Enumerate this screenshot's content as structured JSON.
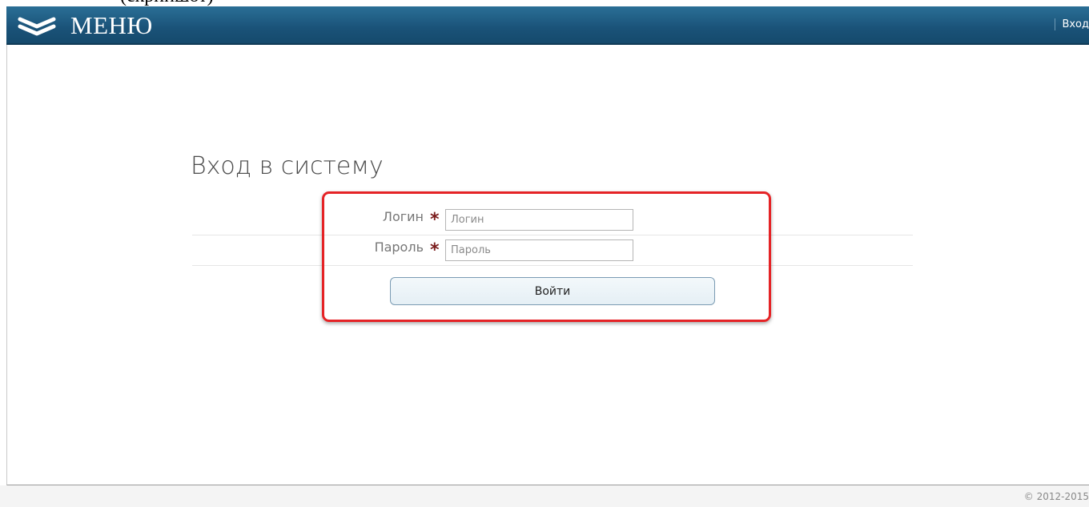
{
  "header": {
    "menu_title": "МЕНЮ",
    "login_link": "Вход",
    "menu_icon": "double-chevron-down-icon",
    "bar_color": "#1a5278"
  },
  "page": {
    "title": "Вход в систему"
  },
  "form": {
    "login_label": "Логин",
    "login_placeholder": "Логин",
    "login_value": "",
    "password_label": "Пароль",
    "password_placeholder": "Пароль",
    "password_value": "",
    "required_mark": "*",
    "submit_label": "Войти"
  },
  "annotation": {
    "highlight_color": "#e52326"
  },
  "footer": {
    "copyright": "© 2012-2015"
  }
}
